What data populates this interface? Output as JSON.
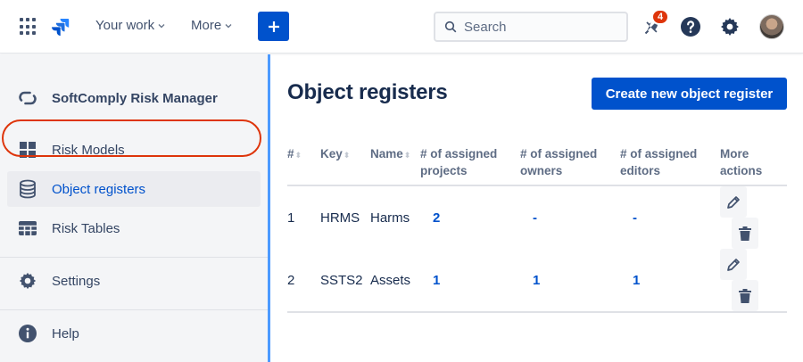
{
  "topbar": {
    "nav": [
      {
        "label": "Your work"
      },
      {
        "label": "More"
      }
    ],
    "search": {
      "placeholder": "Search"
    },
    "notifications_count": "4"
  },
  "sidebar": {
    "brand": "SoftComply Risk Manager",
    "items": [
      {
        "label": "Risk Models",
        "icon": "grid-icon"
      },
      {
        "label": "Object registers",
        "icon": "database-icon",
        "active": true
      },
      {
        "label": "Risk Tables",
        "icon": "table-icon"
      },
      {
        "label": "Settings",
        "icon": "gear-icon"
      },
      {
        "label": "Help",
        "icon": "info-icon"
      }
    ]
  },
  "main": {
    "title": "Object registers",
    "create_label": "Create new object register",
    "table": {
      "headers": [
        "#",
        "Key",
        "Name",
        "# of assigned projects",
        "# of assigned owners",
        "# of assigned editors",
        "More actions"
      ],
      "rows": [
        {
          "index": "1",
          "key": "HRMS",
          "name": "Harms",
          "projects": "2",
          "owners": "-",
          "editors": "-"
        },
        {
          "index": "2",
          "key": "SSTS2",
          "name": "Assets",
          "projects": "1",
          "owners": "1",
          "editors": "1"
        }
      ]
    }
  },
  "colors": {
    "brand_blue": "#0052CC",
    "sidebar_bg": "#F4F5F7",
    "highlight_ring": "#DE350B",
    "badge": "#DE350B"
  }
}
